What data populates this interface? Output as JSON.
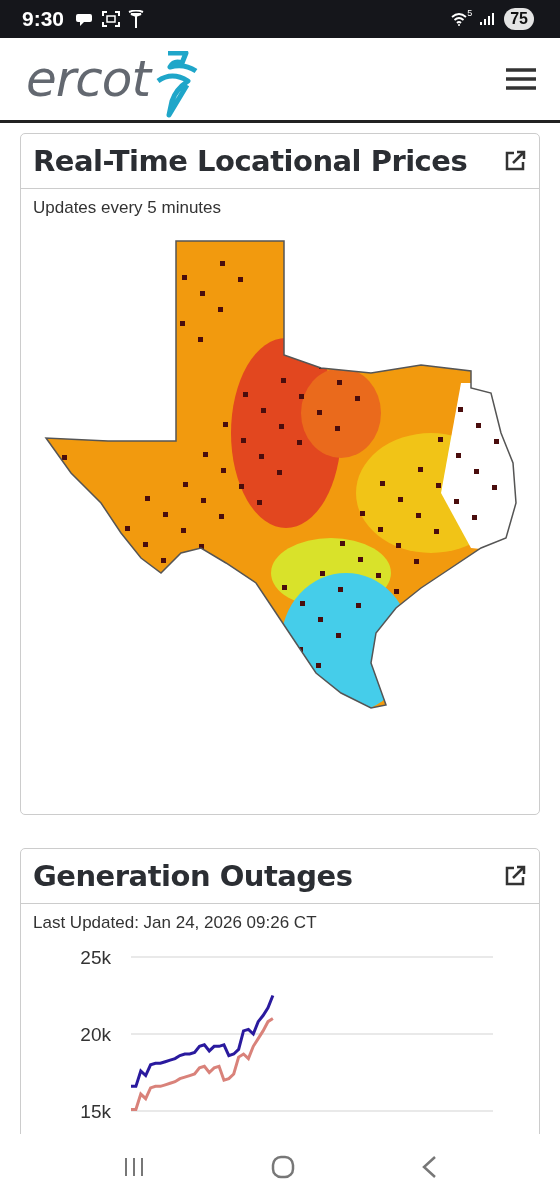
{
  "status_bar": {
    "time": "9:30",
    "wifi_label": "5",
    "battery": "75"
  },
  "header": {
    "logo": "ercot"
  },
  "cards": [
    {
      "title": "Real-Time Locational Prices",
      "subtitle": "Updates every 5 minutes",
      "kind": "map"
    },
    {
      "title": "Generation Outages",
      "subtitle": "Last Updated: Jan 24, 2026 09:26 CT",
      "kind": "chart",
      "chart_data": {
        "type": "line",
        "categories": [
          null,
          null,
          null,
          null,
          null,
          null,
          null,
          null,
          null,
          null,
          null,
          null,
          null,
          null,
          null,
          null,
          null,
          null,
          null,
          null,
          null,
          null,
          null,
          null,
          null,
          null,
          null,
          null,
          null,
          null,
          null,
          null,
          null,
          null,
          null,
          null,
          null,
          null,
          null,
          null,
          null,
          null,
          null,
          null,
          null,
          null,
          null,
          null,
          null,
          null,
          null,
          null,
          null,
          null,
          null,
          null,
          null,
          null,
          null,
          null,
          null,
          null,
          null,
          null,
          null,
          null,
          null,
          null,
          null,
          null,
          null,
          null,
          null,
          null,
          null
        ],
        "ylim": [
          15000,
          25000
        ],
        "yticks": [
          {
            "value": 15000,
            "label": "15k"
          },
          {
            "value": 20000,
            "label": "20k"
          },
          {
            "value": 25000,
            "label": "25k"
          }
        ],
        "series": [
          {
            "color": "#2a1a9e",
            "values": [
              16600,
              16600,
              17600,
              17300,
              18000,
              18100,
              18100,
              18200,
              18300,
              18400,
              18600,
              18700,
              18700,
              18800,
              19200,
              19300,
              18900,
              19200,
              19200,
              19300,
              18600,
              18700,
              19000,
              20200,
              20300,
              20000,
              20800,
              21200,
              21700,
              22500,
              null,
              null,
              null,
              null,
              null,
              null,
              null,
              null,
              null,
              null,
              null,
              null,
              null,
              null,
              null,
              null,
              null,
              null,
              null,
              null,
              null,
              null,
              null,
              null,
              null,
              null,
              null,
              null,
              null,
              null,
              null,
              null,
              null,
              null,
              null,
              null,
              null,
              null,
              null,
              null,
              null,
              null,
              null,
              null,
              null
            ]
          },
          {
            "color": "#d9827a",
            "values": [
              15100,
              15100,
              16100,
              15800,
              16500,
              16600,
              16600,
              16700,
              16800,
              16900,
              17100,
              17200,
              17300,
              17400,
              17800,
              17900,
              17500,
              17800,
              17900,
              17000,
              17100,
              17400,
              18500,
              18700,
              18400,
              19200,
              19700,
              20200,
              20800,
              21000,
              null,
              null,
              null,
              null,
              null,
              null,
              null,
              null,
              null,
              null,
              null,
              null,
              null,
              null,
              null,
              null,
              null,
              null,
              null,
              null,
              null,
              null,
              null,
              null,
              null,
              null,
              null,
              null,
              null,
              null,
              null,
              null,
              null,
              null,
              null,
              null,
              null,
              null,
              null,
              null,
              null,
              null,
              null,
              null,
              null
            ]
          }
        ]
      }
    }
  ]
}
